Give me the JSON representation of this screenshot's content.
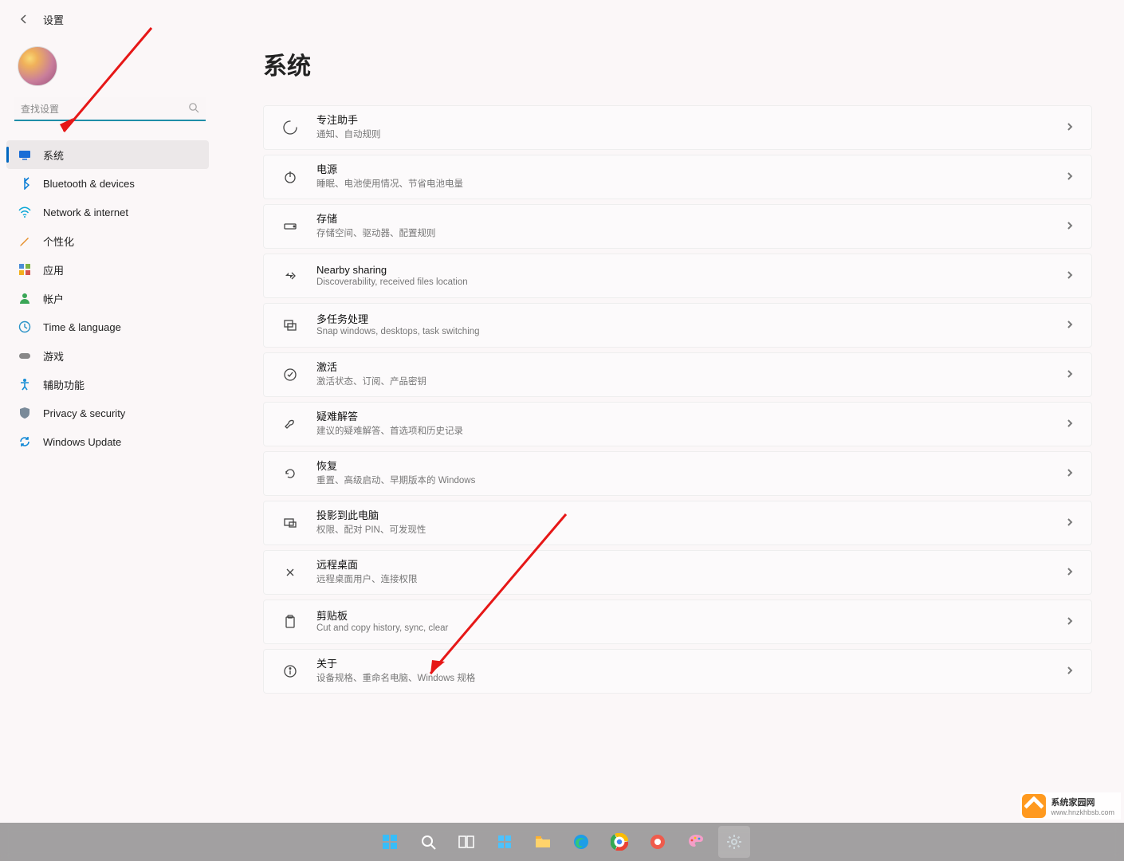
{
  "header": {
    "title": "设置"
  },
  "search": {
    "placeholder": "查找设置"
  },
  "nav": [
    {
      "id": "system",
      "label": "系统",
      "selected": true
    },
    {
      "id": "bluetooth",
      "label": "Bluetooth & devices"
    },
    {
      "id": "network",
      "label": "Network & internet"
    },
    {
      "id": "personal",
      "label": "个性化"
    },
    {
      "id": "apps",
      "label": "应用"
    },
    {
      "id": "accounts",
      "label": "帐户"
    },
    {
      "id": "time",
      "label": "Time & language"
    },
    {
      "id": "gaming",
      "label": "游戏"
    },
    {
      "id": "access",
      "label": "辅助功能"
    },
    {
      "id": "privacy",
      "label": "Privacy & security"
    },
    {
      "id": "update",
      "label": "Windows Update"
    }
  ],
  "page": {
    "title": "系统"
  },
  "items": [
    {
      "id": "focus",
      "title": "专注助手",
      "desc": "通知、自动规则"
    },
    {
      "id": "power",
      "title": "电源",
      "desc": "睡眠、电池使用情况、节省电池电量"
    },
    {
      "id": "storage",
      "title": "存储",
      "desc": "存储空间、驱动器、配置规则"
    },
    {
      "id": "nearby",
      "title": "Nearby sharing",
      "desc": "Discoverability, received files location"
    },
    {
      "id": "multi",
      "title": "多任务处理",
      "desc": "Snap windows, desktops, task switching"
    },
    {
      "id": "activate",
      "title": "激活",
      "desc": "激活状态、订阅、产品密钥"
    },
    {
      "id": "trouble",
      "title": "疑难解答",
      "desc": "建议的疑难解答、首选项和历史记录"
    },
    {
      "id": "recovery",
      "title": "恢复",
      "desc": "重置、高级启动、早期版本的 Windows"
    },
    {
      "id": "project",
      "title": "投影到此电脑",
      "desc": "权限、配对 PIN、可发现性"
    },
    {
      "id": "remote",
      "title": "远程桌面",
      "desc": "远程桌面用户、连接权限"
    },
    {
      "id": "clip",
      "title": "剪贴板",
      "desc": "Cut and copy history, sync, clear"
    },
    {
      "id": "about",
      "title": "关于",
      "desc": "设备规格、重命名电脑、Windows 规格"
    }
  ],
  "watermark": {
    "name": "系统家园网",
    "url": "www.hnzkhbsb.com"
  },
  "taskbar": [
    "start",
    "search",
    "taskview",
    "widgets",
    "explorer",
    "edge",
    "chrome",
    "browser",
    "paint",
    "settings"
  ]
}
